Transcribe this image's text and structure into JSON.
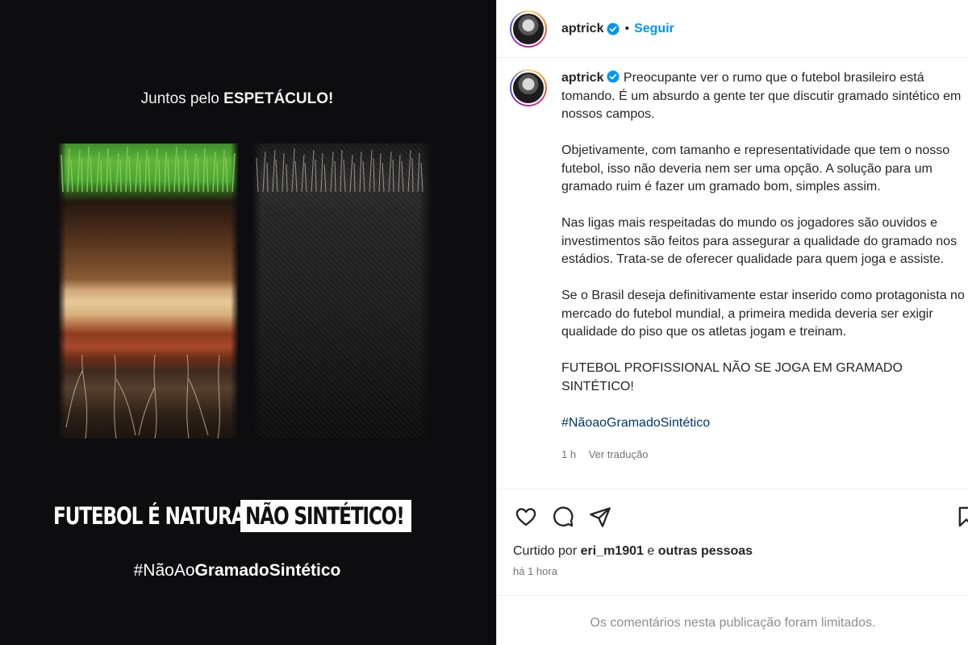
{
  "poster": {
    "top_line_prefix": "Juntos pelo ",
    "top_line_bold": "ESPETÁCULO!",
    "slogan_part1": "FUTEBOL É NATURAL,",
    "slogan_part2": "NÃO SINTÉTICO!",
    "hashtag_prefix": "#NãoAo",
    "hashtag_bold": "GramadoSintético"
  },
  "header": {
    "username": "aptrick",
    "separator": "•",
    "follow_label": "Seguir"
  },
  "caption": {
    "username": "aptrick",
    "intro": "Preocupante ver o rumo que o futebol brasileiro está tomando. É um absurdo a gente ter que discutir gramado sintético em nossos campos.",
    "p2": "Objetivamente, com tamanho e representatividade que tem o nosso futebol, isso não deveria nem ser uma opção. A solução para um gramado ruim é fazer um gramado bom, simples assim.",
    "p3": "Nas ligas mais respeitadas do mundo os jogadores são ouvidos e investimentos são feitos para assegurar a qualidade do gramado nos estádios. Trata-se de oferecer qualidade para quem joga e assiste.",
    "p4": "Se o Brasil deseja definitivamente estar inserido como protagonista no mercado do futebol mundial, a primeira medida deveria ser exigir qualidade do piso que os atletas jogam e treinam.",
    "p5": "FUTEBOL PROFISSIONAL NÃO SE JOGA EM GRAMADO SINTÉTICO!",
    "hashtag": "#NãoaoGramadoSintético",
    "time": "1 h",
    "translate_label": "Ver tradução"
  },
  "actions": {
    "icons": [
      "heart-icon",
      "comment-icon",
      "share-icon",
      "bookmark-icon"
    ],
    "liked_by_prefix": "Curtido por ",
    "liked_by_user": "eri_m1901",
    "liked_by_conj": " e ",
    "liked_by_others": "outras pessoas",
    "post_time": "há 1 hora"
  },
  "comments_notice": "Os comentários nesta publicação foram limitados.",
  "colors": {
    "accent": "#0095f6",
    "verified": "#0095f6",
    "link": "#00376b",
    "muted": "#737373",
    "poster_bg": "#0d0d0f"
  }
}
